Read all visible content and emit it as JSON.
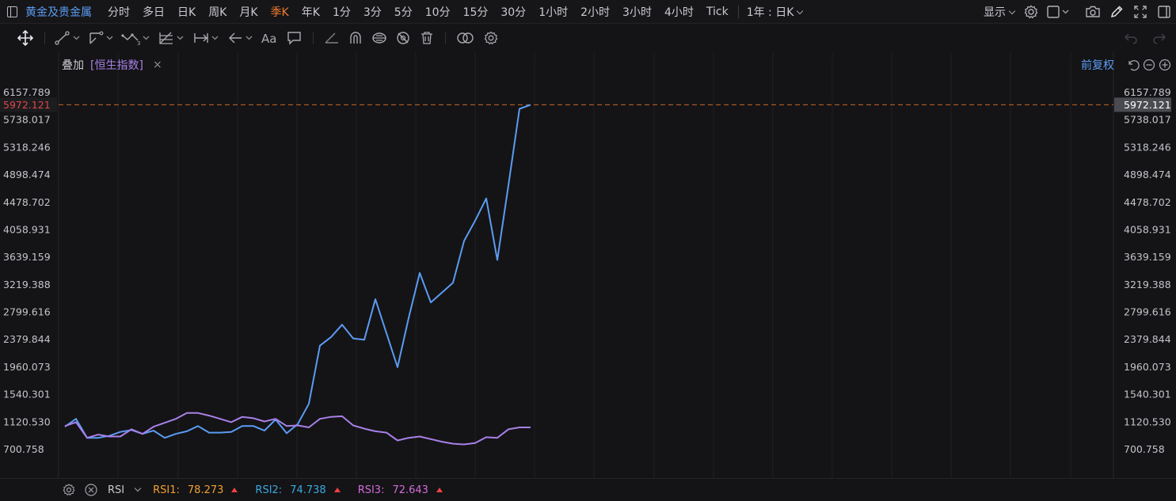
{
  "topbar": {
    "symbol": "黄金及贵金属",
    "periods": [
      {
        "label": "分时",
        "active": false
      },
      {
        "label": "多日",
        "active": false
      },
      {
        "label": "日K",
        "active": false
      },
      {
        "label": "周K",
        "active": false
      },
      {
        "label": "月K",
        "active": false
      },
      {
        "label": "季K",
        "active": true
      },
      {
        "label": "年K",
        "active": false
      },
      {
        "label": "1分",
        "active": false
      },
      {
        "label": "3分",
        "active": false
      },
      {
        "label": "5分",
        "active": false
      },
      {
        "label": "10分",
        "active": false
      },
      {
        "label": "15分",
        "active": false
      },
      {
        "label": "30分",
        "active": false
      },
      {
        "label": "1小时",
        "active": false
      },
      {
        "label": "2小时",
        "active": false
      },
      {
        "label": "3小时",
        "active": false
      },
      {
        "label": "4小时",
        "active": false
      },
      {
        "label": "Tick",
        "active": false
      }
    ],
    "range_label": "1年 : 日K",
    "display_label": "显示",
    "active_color": "#f07a2f",
    "symbol_color": "#5b9bf2"
  },
  "overlay": {
    "label": "叠加",
    "item": "[恒生指数]",
    "close": "×"
  },
  "adjust": {
    "label": "前复权"
  },
  "price_marker": {
    "value": "5972.121",
    "color": "#e0474c"
  },
  "y_axis_labels": [
    "6157.789",
    "5738.017",
    "5318.246",
    "4898.474",
    "4478.702",
    "4058.931",
    "3639.159",
    "3219.388",
    "2799.616",
    "2379.844",
    "1960.073",
    "1540.301",
    "1120.530",
    "700.758"
  ],
  "chart_data": {
    "type": "line",
    "ylim": [
      700.758,
      6157.789
    ],
    "series": [
      {
        "color": "#5b9bf2",
        "values": [
          1050,
          1170,
          880,
          880,
          910,
          970,
          1000,
          940,
          990,
          880,
          940,
          980,
          1060,
          960,
          960,
          970,
          1060,
          1060,
          990,
          1160,
          950,
          1090,
          1400,
          2290,
          2420,
          2610,
          2400,
          2380,
          3000,
          2480,
          1960,
          2710,
          3400,
          2950,
          3100,
          3250,
          3890,
          4200,
          4540,
          3600,
          4740,
          5910,
          5972
        ]
      },
      {
        "color": "#a880e8",
        "values": [
          1060,
          1120,
          880,
          930,
          900,
          900,
          1010,
          940,
          1050,
          1110,
          1170,
          1260,
          1260,
          1220,
          1170,
          1120,
          1200,
          1180,
          1130,
          1170,
          1060,
          1070,
          1040,
          1170,
          1200,
          1210,
          1070,
          1020,
          980,
          960,
          840,
          880,
          900,
          860,
          820,
          790,
          780,
          800,
          890,
          880,
          1010,
          1040,
          1040
        ]
      }
    ]
  },
  "rsi": {
    "name": "RSI",
    "items": [
      {
        "label": "RSI1:",
        "value": "78.273",
        "color": "#f0a030"
      },
      {
        "label": "RSI2:",
        "value": "74.738",
        "color": "#39a9e0"
      },
      {
        "label": "RSI3:",
        "value": "72.643",
        "color": "#d36bd9"
      }
    ]
  }
}
